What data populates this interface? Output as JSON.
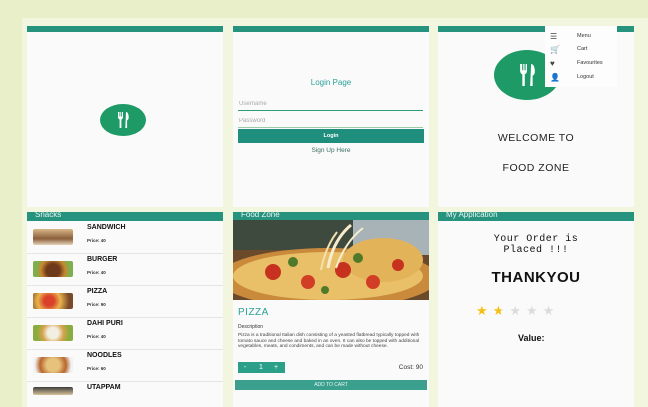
{
  "colors": {
    "accent": "#26937f",
    "logo": "#1e9a66",
    "star": "#f5c013"
  },
  "splash": {
    "logo_icon": "fork-knife-icon"
  },
  "login": {
    "title": "Login Page",
    "username_placeholder": "Username",
    "password_placeholder": "Password",
    "login_button": "Login",
    "signup_link": "Sign Up Here"
  },
  "home": {
    "menu": [
      {
        "icon": "menu-icon",
        "label": "Menu"
      },
      {
        "icon": "cart-icon",
        "label": "Cart"
      },
      {
        "icon": "heart-icon",
        "label": "Favourites"
      },
      {
        "icon": "logout-icon",
        "label": "Logout"
      }
    ],
    "welcome_line1": "WELCOME TO",
    "welcome_line2": "FOOD ZONE"
  },
  "snacks": {
    "title": "Snacks",
    "items": [
      {
        "name": "SANDWICH",
        "price": "Price: 40"
      },
      {
        "name": "BURGER",
        "price": "Price: 40"
      },
      {
        "name": "PIZZA",
        "price": "Price: 90"
      },
      {
        "name": "DAHI PURI",
        "price": "Price: 40"
      },
      {
        "name": "NOODLES",
        "price": "Price: 60"
      },
      {
        "name": "UTAPPAM",
        "price": ""
      }
    ]
  },
  "detail": {
    "title": "Food Zone",
    "name": "PIZZA",
    "desc_label": "Description",
    "description": "Pizza is a traditional Italian dish consisting of a yeasted flatbread typically topped with tomato sauce and cheese and baked in an oven. It can also be topped with additional vegetables, meats, and condiments, and can be made without cheese.",
    "minus": "-",
    "qty": "1",
    "plus": "+",
    "cost": "Cost: 90",
    "add_to_cart": "ADD TO CART"
  },
  "order": {
    "title": "My Application",
    "message_line1": "Your Order is",
    "message_line2": "Placed !!!",
    "thanks": "THANKYOU",
    "rating": 1.5,
    "rating_max": 5,
    "value_label": "Value:"
  }
}
